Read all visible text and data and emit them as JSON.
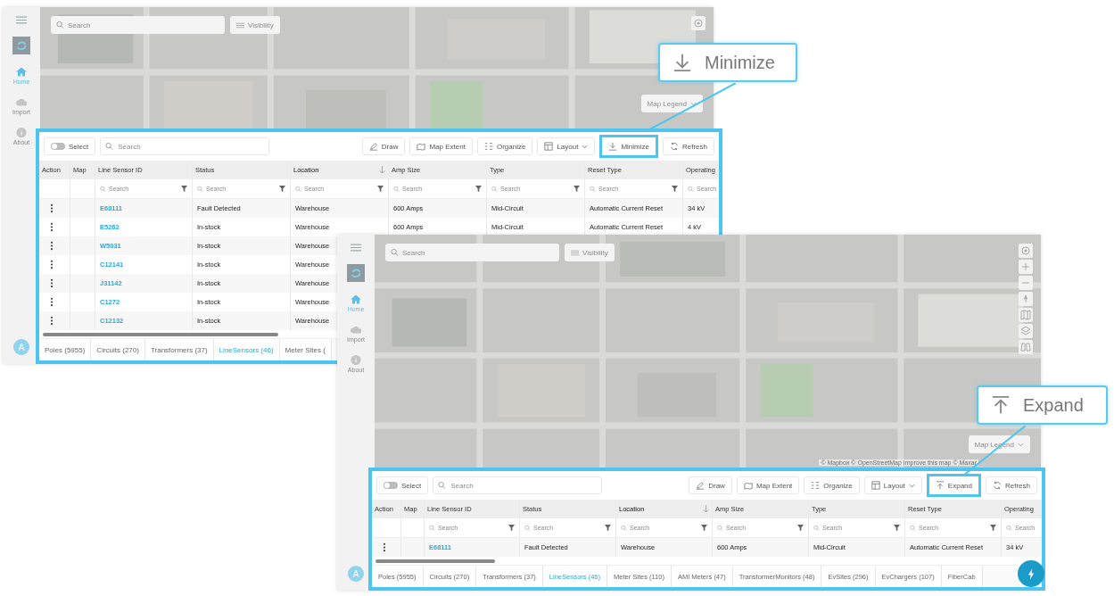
{
  "screens": [
    {
      "sidebar": {
        "items": [
          {
            "label": "Home",
            "kind": "home",
            "selected": true
          },
          {
            "label": "Import",
            "kind": "import",
            "selected": false
          },
          {
            "label": "About",
            "kind": "about",
            "selected": false
          }
        ],
        "avatar": "A"
      },
      "map": {
        "search_placeholder": "Search",
        "visibility": "Visibility",
        "legend": "Map Legend",
        "controls": [
          {
            "kind": "locate"
          }
        ]
      },
      "panel": {
        "select": {
          "label": "Select",
          "on": false
        },
        "search_placeholder": "Search",
        "tools": [
          {
            "label": "Draw",
            "kind": "draw",
            "highlighted": false
          },
          {
            "label": "Map Extent",
            "kind": "map-extent",
            "highlighted": false
          },
          {
            "label": "Organize",
            "kind": "organize",
            "highlighted": false
          },
          {
            "label": "Layout",
            "kind": "layout",
            "highlighted": false
          },
          {
            "label": "Minimize",
            "kind": "minimize",
            "highlighted": true
          },
          {
            "label": "Refresh",
            "kind": "refresh",
            "highlighted": false
          }
        ],
        "columns": [
          {
            "label": "Action",
            "sorted": false
          },
          {
            "label": "Map",
            "sorted": false
          },
          {
            "label": "Line Sensor ID",
            "sorted": false,
            "filter": {
              "placeholder": "Search"
            }
          },
          {
            "label": "Status",
            "sorted": false,
            "filter": {
              "placeholder": "Search"
            }
          },
          {
            "label": "Location",
            "sorted": true,
            "filter": {
              "placeholder": "Search"
            }
          },
          {
            "label": "Amp Size",
            "sorted": false,
            "filter": {
              "placeholder": "Search"
            }
          },
          {
            "label": "Type",
            "sorted": false,
            "filter": {
              "placeholder": "Search"
            }
          },
          {
            "label": "Reset Type",
            "sorted": false,
            "filter": {
              "placeholder": "Search"
            }
          },
          {
            "label": "Operating",
            "sorted": false,
            "filter": {
              "placeholder": "Search"
            }
          }
        ],
        "rows": [
          {
            "cells": [
              "",
              "",
              "E68111",
              "Fault Detected",
              "Warehouse",
              "600 Amps",
              "Mid-Circuit",
              "Automatic Current Reset",
              "34 kV"
            ]
          },
          {
            "cells": [
              "",
              "",
              "E5262",
              "In-stock",
              "Warehouse",
              "600 Amps",
              "Mid-Circuit",
              "Automatic Current Reset",
              "4 kV"
            ]
          },
          {
            "cells": [
              "",
              "",
              "W5031",
              "In-stock",
              "Warehouse"
            ]
          },
          {
            "cells": [
              "",
              "",
              "C12141",
              "In-stock",
              "Warehouse"
            ]
          },
          {
            "cells": [
              "",
              "",
              "J31142",
              "In-stock",
              "Warehouse"
            ]
          },
          {
            "cells": [
              "",
              "",
              "C1272",
              "In-stock",
              "Warehouse"
            ]
          },
          {
            "cells": [
              "",
              "",
              "C12132",
              "In-stock",
              "Warehouse"
            ]
          }
        ],
        "tabs": [
          {
            "label": "Poles (5955)",
            "selected": false
          },
          {
            "label": "Circuits (270)",
            "selected": false
          },
          {
            "label": "Transformers (37)",
            "selected": false
          },
          {
            "label": "LineSensors (46)",
            "selected": true
          },
          {
            "label": "Meter Sites (",
            "selected": false
          }
        ]
      },
      "callout": {
        "label": "Minimize",
        "kind": "minimize"
      }
    },
    {
      "sidebar": {
        "items": [
          {
            "label": "Home",
            "kind": "home",
            "selected": true
          },
          {
            "label": "Import",
            "kind": "import",
            "selected": false
          },
          {
            "label": "About",
            "kind": "about",
            "selected": false
          }
        ],
        "avatar": "A"
      },
      "map": {
        "search_placeholder": "Search",
        "visibility": "Visibility",
        "legend": "Map Legend",
        "attribution": "© Mapbox © OpenStreetMap Improve this map © Maxar",
        "controls": [
          {
            "kind": "locate"
          },
          {
            "kind": "zoom-in"
          },
          {
            "kind": "zoom-out"
          },
          {
            "kind": "compass"
          },
          {
            "kind": "map"
          },
          {
            "kind": "layers"
          },
          {
            "kind": "binoculars"
          }
        ]
      },
      "panel": {
        "select": {
          "label": "Select",
          "on": false
        },
        "search_placeholder": "Search",
        "tools": [
          {
            "label": "Draw",
            "kind": "draw",
            "highlighted": false
          },
          {
            "label": "Map Extent",
            "kind": "map-extent",
            "highlighted": false
          },
          {
            "label": "Organize",
            "kind": "organize",
            "highlighted": false
          },
          {
            "label": "Layout",
            "kind": "layout",
            "highlighted": false
          },
          {
            "label": "Expand",
            "kind": "expand",
            "highlighted": true
          },
          {
            "label": "Refresh",
            "kind": "refresh",
            "highlighted": false
          }
        ],
        "columns": [
          {
            "label": "Action",
            "sorted": false
          },
          {
            "label": "Map",
            "sorted": false
          },
          {
            "label": "Line Sensor ID",
            "sorted": false,
            "filter": {
              "placeholder": "Search"
            }
          },
          {
            "label": "Status",
            "sorted": false,
            "filter": {
              "placeholder": "Search"
            }
          },
          {
            "label": "Location",
            "sorted": true,
            "filter": {
              "placeholder": "Search"
            }
          },
          {
            "label": "Amp Size",
            "sorted": false,
            "filter": {
              "placeholder": "Search"
            }
          },
          {
            "label": "Type",
            "sorted": false,
            "filter": {
              "placeholder": "Search"
            }
          },
          {
            "label": "Reset Type",
            "sorted": false,
            "filter": {
              "placeholder": "Search"
            }
          },
          {
            "label": "Operating",
            "sorted": false,
            "filter": {
              "placeholder": "Search"
            }
          }
        ],
        "rows": [
          {
            "cells": [
              "",
              "",
              "E68111",
              "Fault Detected",
              "Warehouse",
              "600 Amps",
              "Mid-Circuit",
              "Automatic Current Reset",
              "34 kV"
            ]
          }
        ],
        "tabs": [
          {
            "label": "Poles (5955)",
            "selected": false
          },
          {
            "label": "Circuits (270)",
            "selected": false
          },
          {
            "label": "Transformers (37)",
            "selected": false
          },
          {
            "label": "LineSensors (46)",
            "selected": true
          },
          {
            "label": "Meter Sites (110)",
            "selected": false
          },
          {
            "label": "AMI Meters (47)",
            "selected": false
          },
          {
            "label": "TransformerMonitors (48)",
            "selected": false
          },
          {
            "label": "EvSites (296)",
            "selected": false
          },
          {
            "label": "EvChargers (107)",
            "selected": false
          },
          {
            "label": "FiberCab",
            "selected": false
          }
        ],
        "fab": true
      },
      "callout": {
        "label": "Expand",
        "kind": "expand"
      }
    }
  ]
}
